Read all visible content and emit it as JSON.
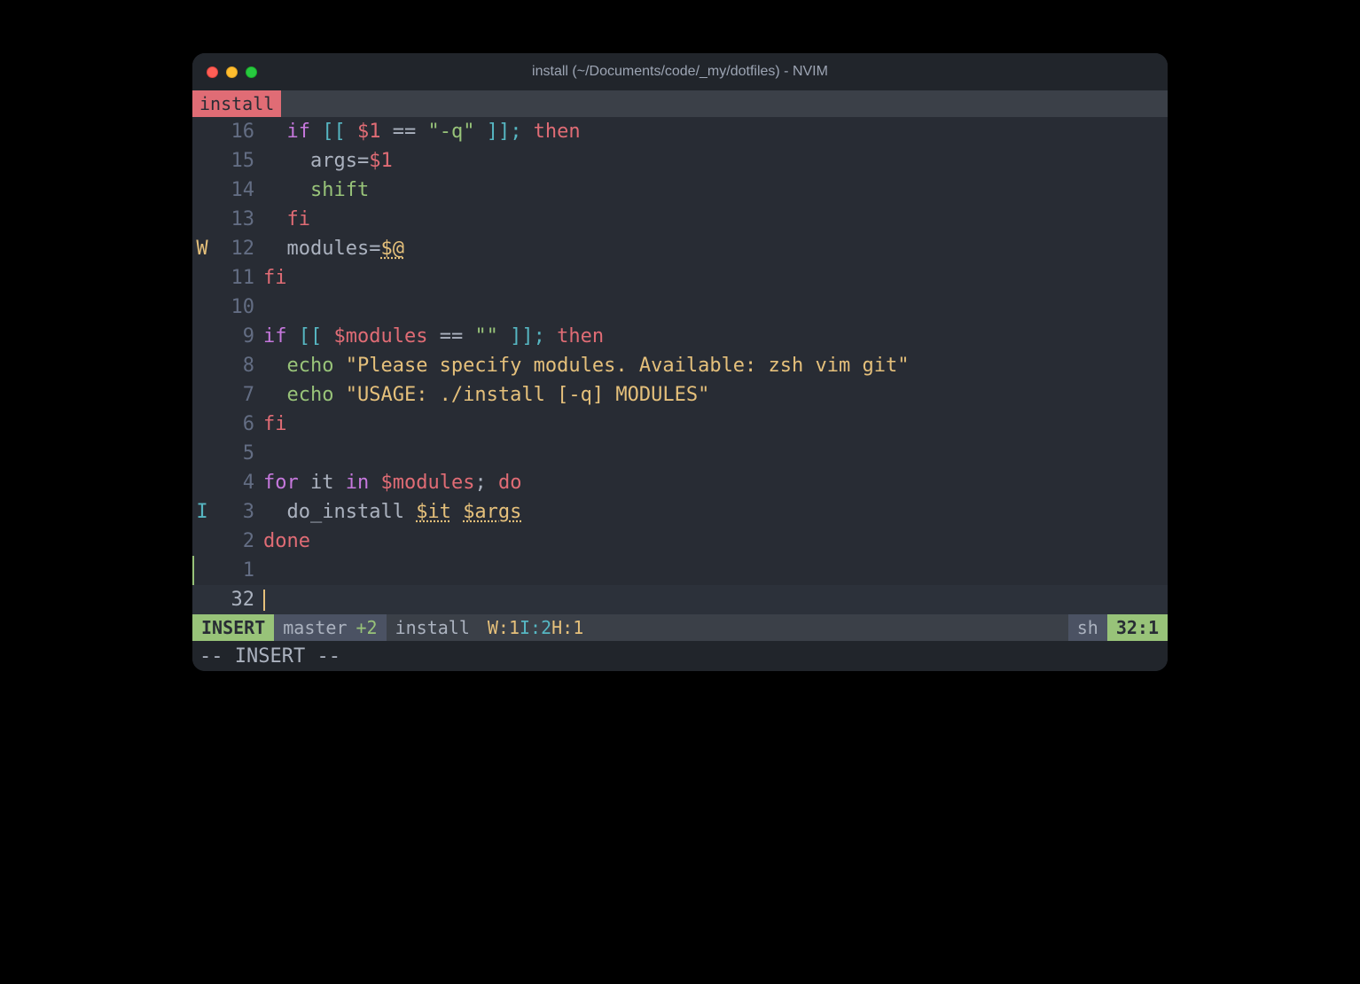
{
  "window": {
    "title": "install (~/Documents/code/_my/dotfiles) - NVIM"
  },
  "tab": {
    "label": "install"
  },
  "gutter": {
    "rel": [
      "16",
      "15",
      "14",
      "13",
      "12",
      "11",
      "10",
      "9",
      "8",
      "7",
      "6",
      "5",
      "4",
      "3",
      "2",
      "1"
    ],
    "abs": "32",
    "signs": {
      "r4": "W",
      "r13": "I"
    }
  },
  "code": {
    "l0_if": "if",
    "l0_br1": " [[ ",
    "l0_var": "$1",
    "l0_eq": " == ",
    "l0_str": "\"-q\"",
    "l0_br2": " ]];",
    "l0_then": " then",
    "l1": "    args=",
    "l1_var": "$1",
    "l2": "    shift",
    "l3": "  fi",
    "l4_lhs": "  modules=",
    "l4_var": "$@",
    "l5": "fi",
    "l6": "",
    "l7_if": "if",
    "l7_br1": " [[ ",
    "l7_var": "$modules",
    "l7_eq": " == ",
    "l7_str": "\"\"",
    "l7_br2": " ]];",
    "l7_then": " then",
    "l8_echo": "  echo ",
    "l8_str": "\"Please specify modules. Available: zsh vim git\"",
    "l9_echo": "  echo ",
    "l9_str": "\"USAGE: ./install [-q] MODULES\"",
    "l10": "fi",
    "l11": "",
    "l12_for": "for",
    "l12_it": " it ",
    "l12_in": "in ",
    "l12_var": "$modules",
    "l12_semi": ";",
    "l12_do": " do",
    "l13_call": "  do_install ",
    "l13_v1": "$it",
    "l13_sp": " ",
    "l13_v2": "$args",
    "l14": "done",
    "l15": ""
  },
  "status": {
    "mode": "INSERT",
    "branch": "master",
    "diff": "+2",
    "file": "install",
    "lint_w": "W:1",
    "lint_i": "I:2",
    "lint_h": "H:1",
    "ft": "sh",
    "pos": "32:1"
  },
  "cmd": {
    "text": "-- INSERT --"
  }
}
